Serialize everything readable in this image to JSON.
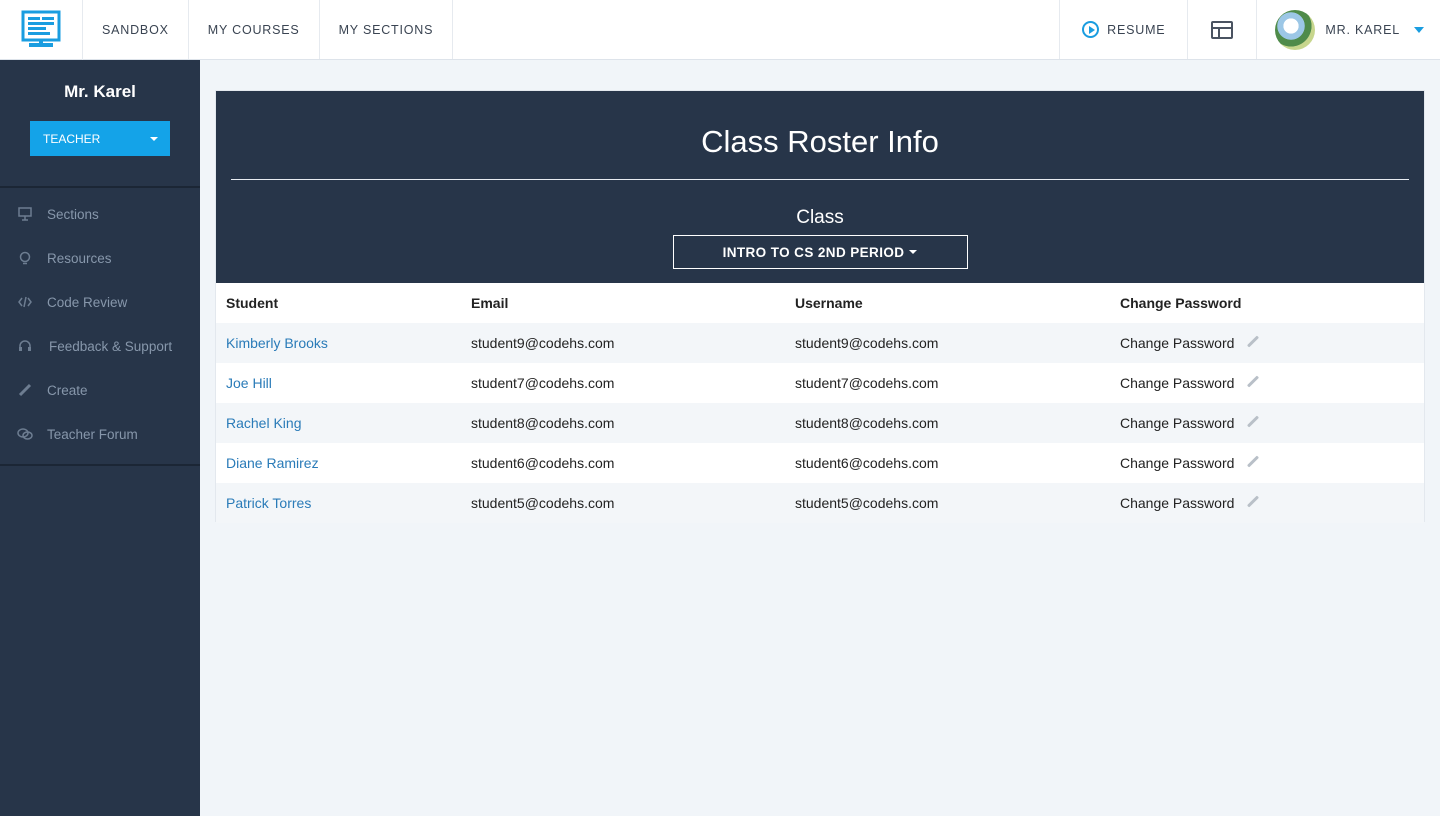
{
  "nav": {
    "links": [
      "SANDBOX",
      "MY COURSES",
      "MY SECTIONS"
    ],
    "resume_label": "RESUME",
    "user_label": "MR. KAREL",
    "accent": "#1a9de0"
  },
  "sidebar": {
    "user_name": "Mr. Karel",
    "role": "TEACHER",
    "items": [
      {
        "label": "Sections",
        "icon": "presentation-icon"
      },
      {
        "label": "Resources",
        "icon": "lightbulb-icon"
      },
      {
        "label": "Code Review",
        "icon": "code-icon"
      },
      {
        "label": "Feedback & Support",
        "icon": "headphones-icon"
      },
      {
        "label": "Create",
        "icon": "pencil-icon"
      },
      {
        "label": "Teacher Forum",
        "icon": "chat-bubbles-icon"
      }
    ]
  },
  "roster": {
    "title": "Class Roster Info",
    "class_label": "Class",
    "class_selected": "INTRO TO CS 2ND PERIOD",
    "columns": [
      "Student",
      "Email",
      "Username",
      "Change Password"
    ],
    "rows": [
      {
        "student": "Kimberly Brooks",
        "email": "student9@codehs.com",
        "username": "student9@codehs.com",
        "action": "Change Password"
      },
      {
        "student": "Joe Hill",
        "email": "student7@codehs.com",
        "username": "student7@codehs.com",
        "action": "Change Password"
      },
      {
        "student": "Rachel King",
        "email": "student8@codehs.com",
        "username": "student8@codehs.com",
        "action": "Change Password"
      },
      {
        "student": "Diane Ramirez",
        "email": "student6@codehs.com",
        "username": "student6@codehs.com",
        "action": "Change Password"
      },
      {
        "student": "Patrick Torres",
        "email": "student5@codehs.com",
        "username": "student5@codehs.com",
        "action": "Change Password"
      }
    ]
  }
}
